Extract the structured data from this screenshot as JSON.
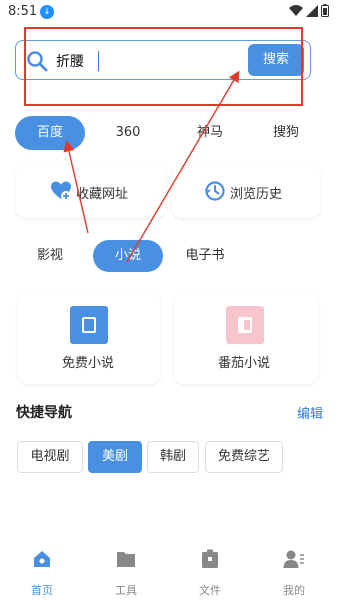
{
  "status": {
    "time": "8:51"
  },
  "search": {
    "value": "折腰",
    "button": "搜索"
  },
  "engines": [
    "百度",
    "360",
    "神马",
    "搜狗"
  ],
  "quick": {
    "favorites": "收藏网址",
    "history": "浏览历史"
  },
  "categories": [
    "影视",
    "小说",
    "电子书"
  ],
  "novels": {
    "free": "免费小说",
    "fanqie": "番茄小说"
  },
  "shortcut": {
    "title": "快捷导航",
    "edit": "编辑",
    "chips": [
      "电视剧",
      "美剧",
      "韩剧",
      "免费综艺"
    ]
  },
  "nav": {
    "home": "首页",
    "tools": "工具",
    "files": "文件",
    "mine": "我的"
  },
  "colors": {
    "accent": "#4a90e2",
    "annotation": "#e03a2c"
  }
}
